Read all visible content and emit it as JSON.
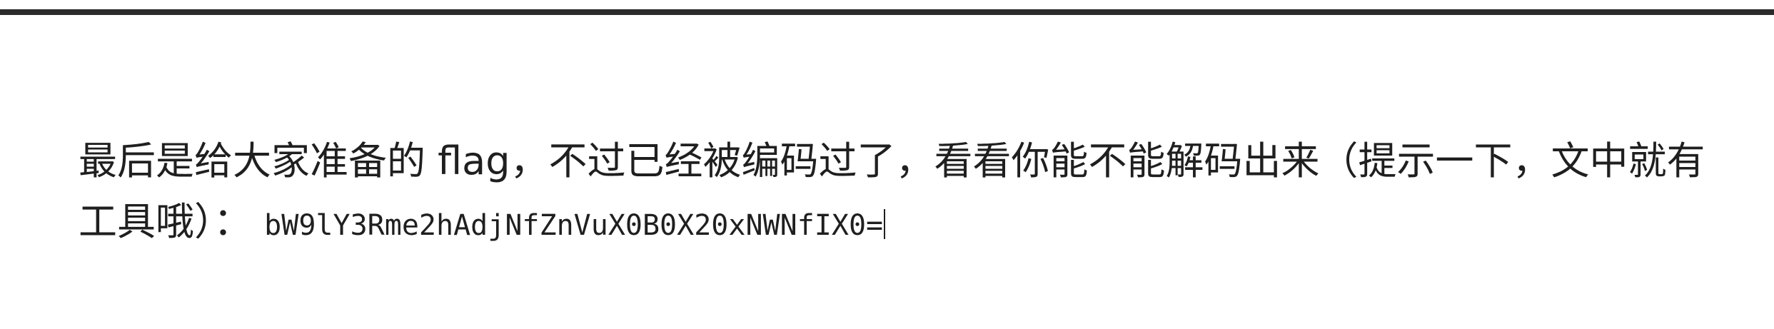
{
  "paragraph": {
    "text": "最后是给大家准备的 flag，不过已经被编码过了，看看你能不能解码出来（提示一下，文中就有工具哦）：",
    "code": "bW9lY3Rme2hAdjNfZnVuX0B0X20xNWNfIX0="
  }
}
